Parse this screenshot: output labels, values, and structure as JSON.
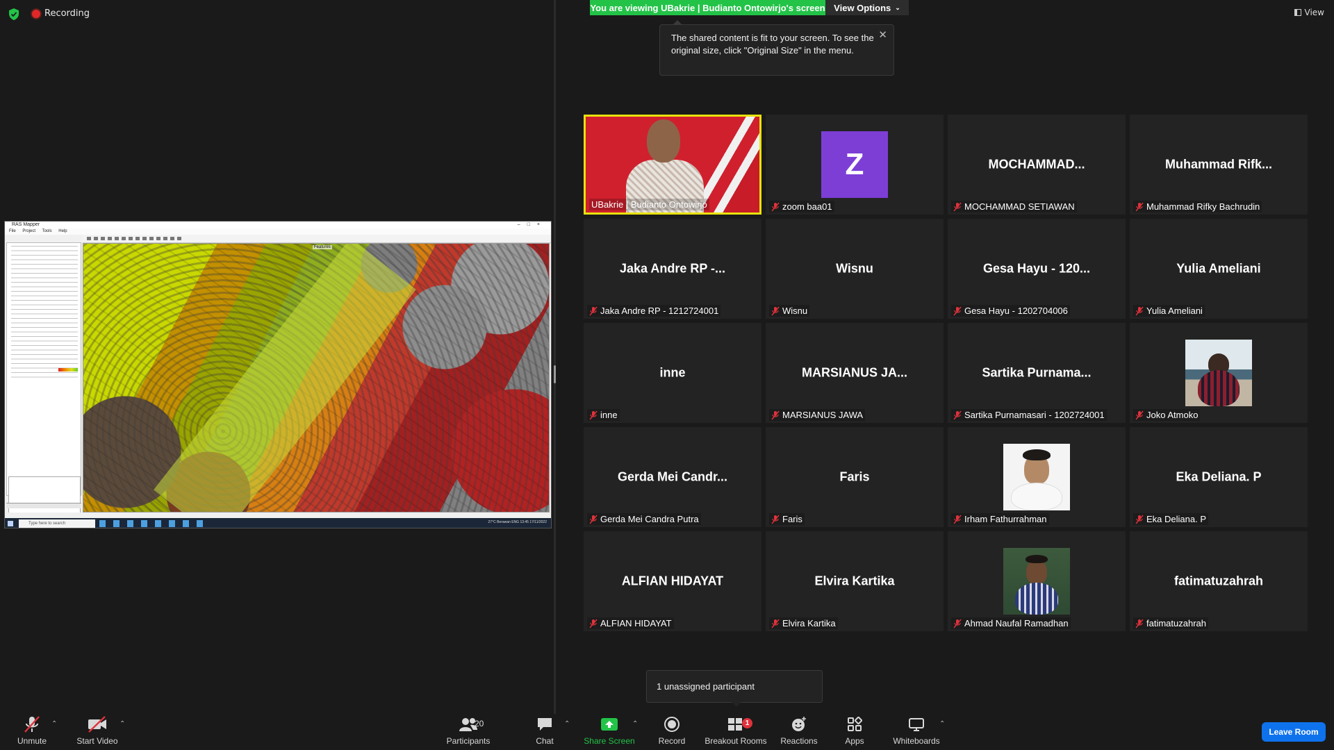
{
  "status": {
    "recording_label": "Recording"
  },
  "banner": {
    "viewing_text": "You are viewing UBakrie | Budianto Ontowirjo's screen",
    "view_options_label": "View Options",
    "view_label": "View"
  },
  "tooltip": {
    "text": "The shared content is fit to your screen. To see the original size, click \"Original Size\" in the menu."
  },
  "shared_screen": {
    "window_title": "RAS Mapper",
    "menu_items": [
      "File",
      "Project",
      "Tools",
      "Help"
    ],
    "map_title": "Features",
    "taskbar_search_placeholder": "Type here to search",
    "tray_text": "27°C Berawan  ENG 13:45 17/11/2022"
  },
  "participants": [
    {
      "display": "",
      "label": "UBakrie | Budianto Ontowirjo",
      "type": "video",
      "active": true
    },
    {
      "display": "Z",
      "label": "zoom baa01",
      "type": "letter"
    },
    {
      "display": "MOCHAMMAD...",
      "label": "MOCHAMMAD SETIAWAN",
      "type": "name"
    },
    {
      "display": "Muhammad  Rifk...",
      "label": "Muhammad Rifky Bachrudin",
      "type": "name"
    },
    {
      "display": "Jaka Andre RP -...",
      "label": "Jaka Andre RP - 1212724001",
      "type": "name"
    },
    {
      "display": "Wisnu",
      "label": "Wisnu",
      "type": "name"
    },
    {
      "display": "Gesa Hayu - 120...",
      "label": "Gesa Hayu - 1202704006",
      "type": "name"
    },
    {
      "display": "Yulia Ameliani",
      "label": "Yulia Ameliani",
      "type": "name"
    },
    {
      "display": "inne",
      "label": "inne",
      "type": "name"
    },
    {
      "display": "MARSIANUS  JA...",
      "label": "MARSIANUS JAWA",
      "type": "name"
    },
    {
      "display": "Sartika  Purnama...",
      "label": "Sartika Purnamasari - 1202724001",
      "type": "name"
    },
    {
      "display": "",
      "label": "Joko Atmoko",
      "type": "photo",
      "photo": "joko"
    },
    {
      "display": "Gerda Mei Candr...",
      "label": "Gerda Mei Candra Putra",
      "type": "name"
    },
    {
      "display": "Faris",
      "label": "Faris",
      "type": "name"
    },
    {
      "display": "",
      "label": "Irham Fathurrahman",
      "type": "photo",
      "photo": "irham"
    },
    {
      "display": "Eka Deliana. P",
      "label": "Eka Deliana. P",
      "type": "name"
    },
    {
      "display": "ALFIAN HIDAYAT",
      "label": "ALFIAN HIDAYAT",
      "type": "name"
    },
    {
      "display": "Elvira Kartika",
      "label": "Elvira Kartika",
      "type": "name"
    },
    {
      "display": "",
      "label": "Ahmad Naufal Ramadhan",
      "type": "photo",
      "photo": "ahmad"
    },
    {
      "display": "fatimatuzahrah",
      "label": "fatimatuzahrah",
      "type": "name"
    }
  ],
  "unassigned": {
    "text": "1 unassigned participant"
  },
  "toolbar": {
    "unmute": "Unmute",
    "start_video": "Start Video",
    "participants": "Participants",
    "participants_count": "20",
    "chat": "Chat",
    "share_screen": "Share Screen",
    "record": "Record",
    "breakout_rooms": "Breakout Rooms",
    "breakout_badge": "1",
    "reactions": "Reactions",
    "apps": "Apps",
    "whiteboards": "Whiteboards",
    "leave_room": "Leave Room"
  },
  "colors": {
    "zoom_green": "#23C348",
    "zoom_blue": "#0E72ED",
    "active_speaker_border": "#E8E20E",
    "avatar_purple": "#7D3ED6",
    "mute_red": "#E0323C"
  }
}
